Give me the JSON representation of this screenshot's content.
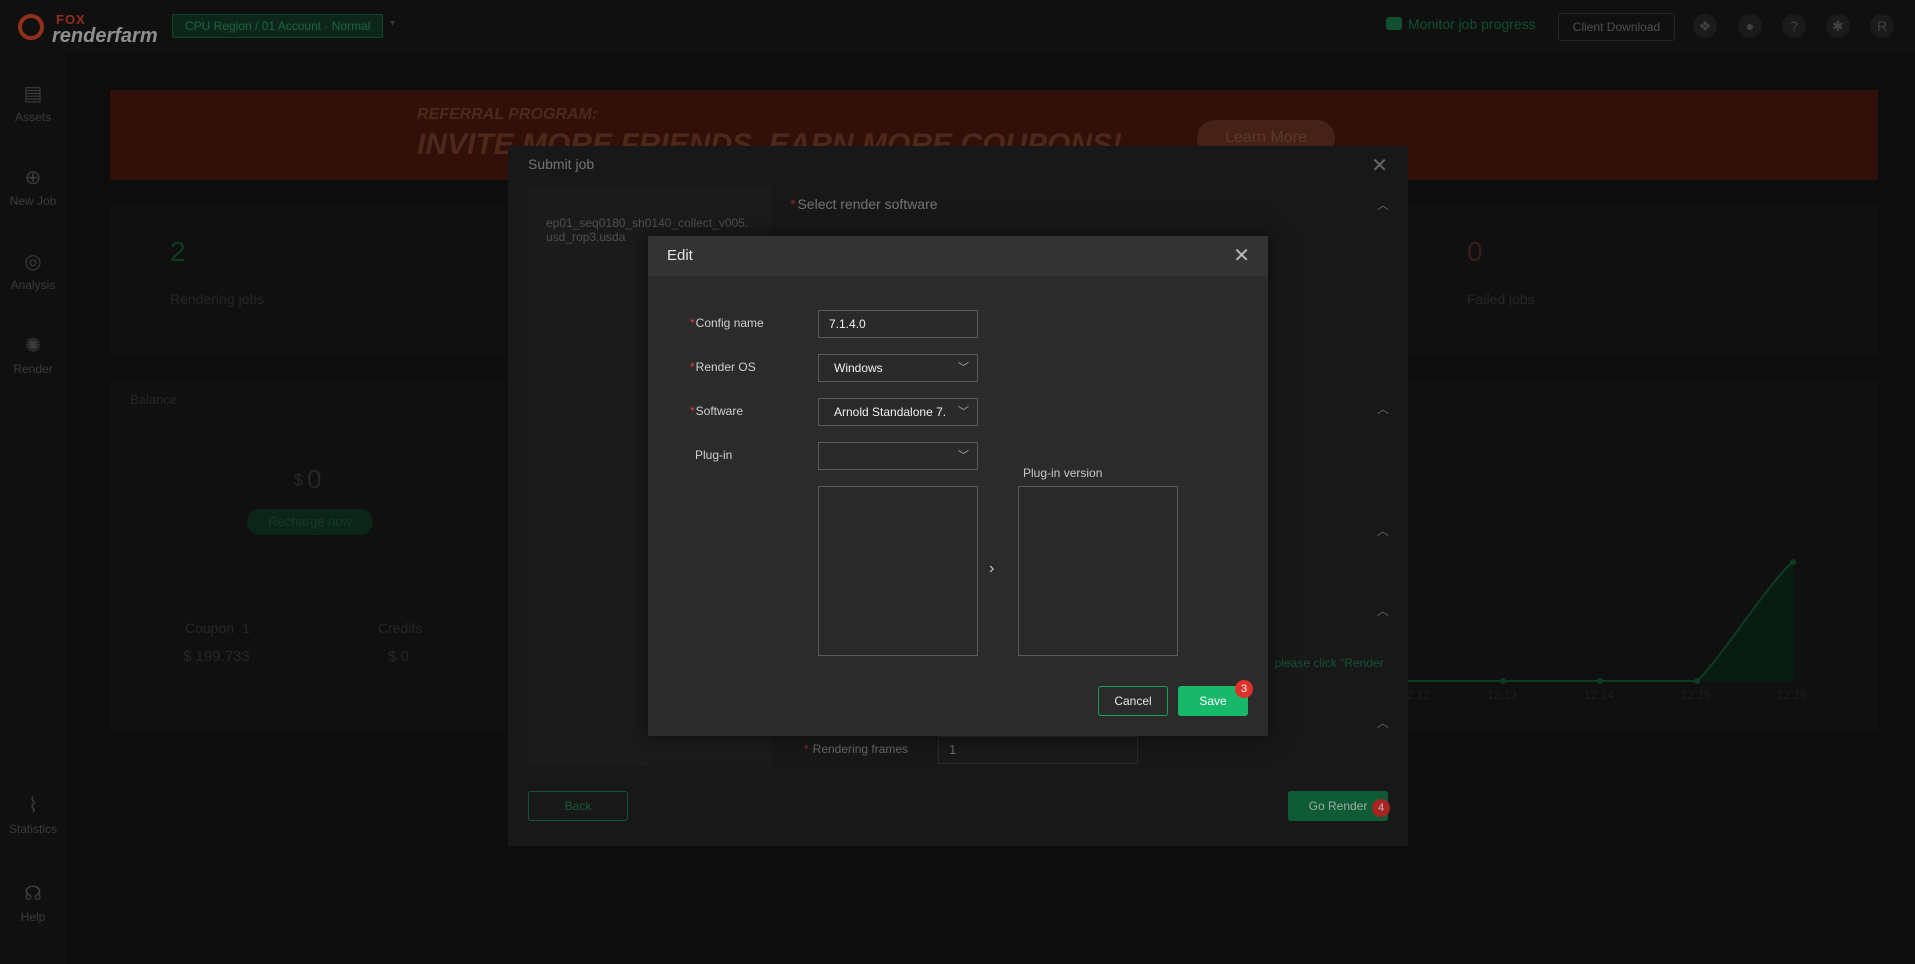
{
  "topbar": {
    "logo_top": "FOX",
    "logo_bottom": "renderfarm",
    "region": "CPU Region / 01 Account · Normal",
    "monitor": "Monitor job progress",
    "client_download": "Client Download",
    "user_initial": "R"
  },
  "sidebar": {
    "items": [
      {
        "label": "Assets"
      },
      {
        "label": "New Job"
      },
      {
        "label": "Analysis"
      },
      {
        "label": "Render"
      },
      {
        "label": "Statistics"
      },
      {
        "label": "Help"
      }
    ]
  },
  "background": {
    "banner_line1": "REFERRAL PROGRAM:",
    "banner_line2": "INVITE MORE FRIENDS, EARN MORE COUPONS!",
    "banner_button": "Learn More",
    "rendering_jobs_count": "2",
    "rendering_jobs_label": "Rendering jobs",
    "failed_jobs_count": "0",
    "failed_jobs_label": "Failed jobs",
    "balance_label": "Balance",
    "balance_currency": "$",
    "balance_value": "0",
    "recharge": "Recharge now",
    "coupon_label": "Coupon",
    "coupon_count": "1",
    "coupon_value": "$ 199.733",
    "credits_label": "Credits",
    "credits_value": "$ 0",
    "chart_dates": [
      "12.12",
      "12.13",
      "12.14",
      "12.15",
      "12.16"
    ]
  },
  "submit_job": {
    "title": "Submit job",
    "file_name": "ep01_seq0180_sh0140_collect_v005.usd_rop3.usda",
    "section_software": "Select render software",
    "hint": ", please click \"Render",
    "frames_label": "Rendering frames",
    "frames_value": "1",
    "back": "Back",
    "go_render": "Go Render",
    "go_badge": "4"
  },
  "edit": {
    "title": "Edit",
    "config_label": "Config name",
    "config_value": "7.1.4.0",
    "os_label": "Render OS",
    "os_value": "Windows",
    "software_label": "Software",
    "software_value": "Arnold Standalone 7.",
    "plugin_label": "Plug-in",
    "plugin_value": "",
    "plugin_version_label": "Plug-in version",
    "cancel": "Cancel",
    "save": "Save",
    "save_badge": "3"
  }
}
